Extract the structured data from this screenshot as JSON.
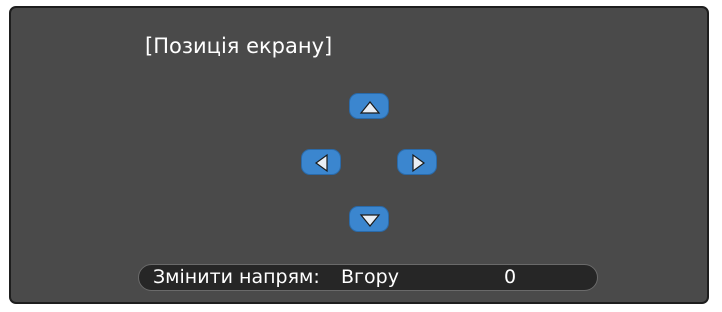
{
  "screen": {
    "title": "[Позиція екрану]"
  },
  "arrows": {
    "up_icon": "triangle-up-icon",
    "left_icon": "triangle-left-icon",
    "right_icon": "triangle-right-icon",
    "down_icon": "triangle-down-icon"
  },
  "status": {
    "label": "Змінити напрям:",
    "direction": "Вгору",
    "value": "0"
  },
  "colors": {
    "panel_background": "#4a4a4a",
    "button_blue": "#3b86cf",
    "status_bar": "#262626",
    "text": "#ffffff"
  }
}
